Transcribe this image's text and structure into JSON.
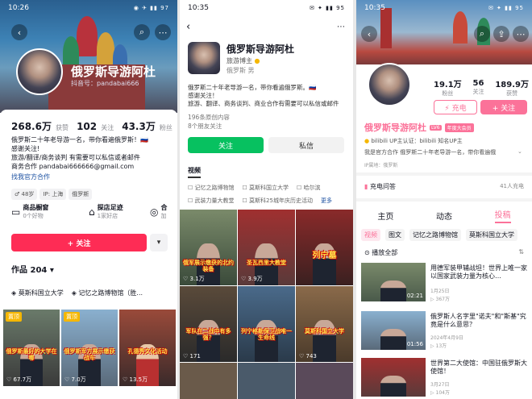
{
  "p1": {
    "time": "10:26",
    "status_icons": "◉ ✈ ▮▮ 97",
    "name": "俄罗斯导游阿杜",
    "id_label": "抖音号：pandabai666",
    "stats": [
      {
        "num": "268.6万",
        "label": "获赞"
      },
      {
        "num": "102",
        "label": "关注"
      },
      {
        "num": "43.3万",
        "label": "粉丝"
      }
    ],
    "bio": [
      "俄罗斯二十年老导游一名，带你看遍俄罗斯！🇷🇺",
      "感谢关注!",
      "旅游/翻译/商务谈判 有需要可以私信或者邮件",
      "商务合作 pandabai666666@gmail.com"
    ],
    "link": "找我官方合作",
    "tags": [
      "♂ 48岁",
      "IP: 上海",
      "俄罗斯"
    ],
    "cards": [
      {
        "title": "商品橱窗",
        "sub": "0个好物"
      },
      {
        "title": "探店足迹",
        "sub": "1家好店"
      },
      {
        "title": "合",
        "sub": "加"
      }
    ],
    "follow_btn": "+ 关注",
    "works_label": "作品 204 ▾",
    "collections": [
      "莫斯科国立大学",
      "记忆之路博物馆（胜..."
    ],
    "thumbs": [
      {
        "caption": "俄罗斯最好的大学在哪",
        "count": "67.7万",
        "badge": "置顶"
      },
      {
        "caption": "俄罗斯军方展示缴获战车",
        "count": "7.0万",
        "badge": "置顶"
      },
      {
        "caption": "孔德秀文化活动",
        "count": "13.5万",
        "badge": ""
      }
    ]
  },
  "p2": {
    "time": "10:35",
    "status_icons": "✉ ✦ ▮▮ 95",
    "name": "俄罗斯导游阿杜",
    "role": "旅游博主",
    "location": "俄罗斯 男",
    "bio": "俄罗斯二十年老导游一名，带你看遍俄罗斯。🇷🇺",
    "bio2": "感谢关注！",
    "bio3": "旅游、翻译、商务谈判、商业合作有需要可以私信或邮件",
    "stats1": "196条原创内容",
    "stats2": "8个朋友关注",
    "follow_btn": "关注",
    "msg_btn": "私信",
    "video_tab": "视频",
    "links": [
      "记忆之路博物馆",
      "莫斯科国立大学",
      "哈尔滨"
    ],
    "links2": [
      "武装力量大教堂",
      "莫斯科25城年庆历史活动"
    ],
    "more": "更多",
    "thumbs": [
      {
        "caption": "俄军展示缴获的北约装备",
        "count": "3.1万"
      },
      {
        "caption": "圣瓦西里大教堂",
        "count": "3.9万"
      },
      {
        "caption": "列宁墓",
        "count": ""
      },
      {
        "caption": "军队在二战中有多强？",
        "count": "171"
      },
      {
        "caption": "列宁格勒保卫战唯一生命线",
        "count": ""
      },
      {
        "caption": "莫斯科国立大学",
        "count": "743"
      }
    ]
  },
  "p3": {
    "time": "10:35",
    "status_icons": "✉ ✦ ▮▮ 95",
    "stats": [
      {
        "num": "19.1万",
        "label": "粉丝"
      },
      {
        "num": "56",
        "label": "关注"
      },
      {
        "num": "189.9万",
        "label": "获赞"
      }
    ],
    "charge_btn": "⚡ 充电",
    "follow_btn": "+ 关注",
    "name": "俄罗斯导游阿杜",
    "lv": "LV6",
    "vip": "年度大会员",
    "up": "bilibili UP主认证：bilibili 知名UP主",
    "coop": "我是官方合作 俄罗斯二十年老导游一名，带你看遍俄",
    "ip": "IP属地：俄罗斯",
    "charge_row": "充电问答",
    "charge_count": "41人充电",
    "tabs": [
      "主页",
      "动态",
      "投稿"
    ],
    "subtabs": [
      "视频",
      "图文",
      "记忆之路博物馆",
      "莫斯科国立大学"
    ],
    "sort": "播放全部",
    "videos": [
      {
        "title": "用德军装甲辅战坦！世界上唯一家以国家武装力量为核心…",
        "meta": "1月25日",
        "views": "367万",
        "duration": "02:21"
      },
      {
        "title": "俄罗斯人名字里\"诺夫\"和\"斯基\"究竟是什么意思？",
        "meta": "2024年4月9日",
        "views": "13万",
        "duration": "01:56"
      },
      {
        "title": "世界第二大使馆：中国驻俄罗斯大使馆！",
        "meta": "3月27日",
        "views": "104万",
        "duration": ""
      }
    ]
  }
}
